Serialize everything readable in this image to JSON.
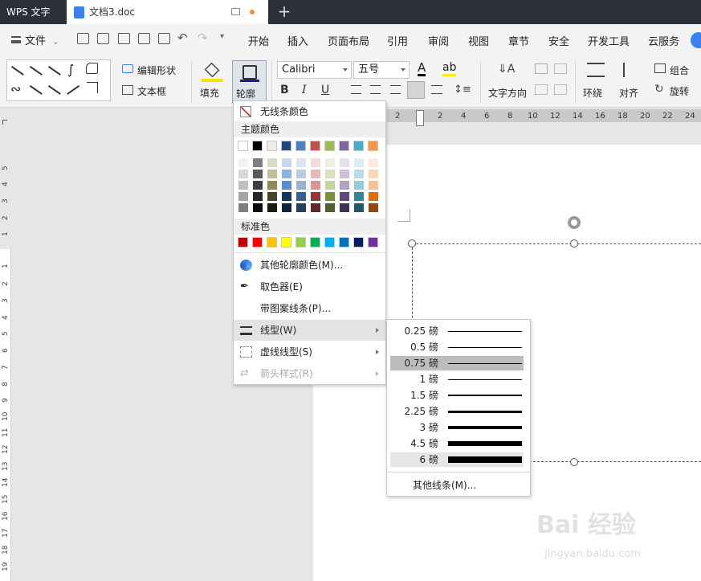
{
  "titlebar": {
    "app_label": "WPS 文字",
    "doc_tab": "文档3.doc",
    "new_tab": "+"
  },
  "menubar": {
    "file": "文件",
    "tabs": [
      "开始",
      "插入",
      "页面布局",
      "引用",
      "审阅",
      "视图",
      "章节",
      "安全",
      "开发工具",
      "云服务"
    ]
  },
  "ribbon": {
    "edit_shape": "编辑形状",
    "text_box": "文本框",
    "fill": "填充",
    "outline": "轮廓",
    "font_name": "Calibri",
    "font_size": "五号",
    "bold": "B",
    "italic": "I",
    "underline": "U",
    "text_direction": "文字方向",
    "wrap": "环绕",
    "align": "对齐",
    "group": "组合",
    "rotate": "旋转"
  },
  "ruler": {
    "h_ticks": [
      "2",
      "2",
      "4",
      "6",
      "8",
      "10",
      "12",
      "14",
      "16",
      "18",
      "20",
      "22",
      "24"
    ],
    "v_ticks_top": [
      "5",
      "4",
      "3",
      "2",
      "1"
    ],
    "v_ticks_bottom": [
      "1",
      "2",
      "3",
      "4",
      "5",
      "6",
      "7",
      "8",
      "9",
      "10",
      "11",
      "12",
      "13",
      "14",
      "15",
      "16",
      "17",
      "18",
      "19"
    ]
  },
  "outline_menu": {
    "no_line": "无线条颜色",
    "theme_colors_title": "主题颜色",
    "standard_colors_title": "标准色",
    "theme_top_row": [
      "#ffffff",
      "#000000",
      "#eeece1",
      "#1f497d",
      "#4f81bd",
      "#c0504d",
      "#9bbb59",
      "#8064a2",
      "#4bacc6",
      "#f79646"
    ],
    "theme_shades": [
      [
        "#f2f2f2",
        "#7f7f7f",
        "#ddd9c3",
        "#c6d9f0",
        "#dbe5f1",
        "#f2dcdb",
        "#ebf1dd",
        "#e5e0ec",
        "#dbeef3",
        "#fdeada"
      ],
      [
        "#d8d8d8",
        "#595959",
        "#c4bd97",
        "#8db3e2",
        "#b8cce4",
        "#e5b9b7",
        "#d7e3bc",
        "#ccc1d9",
        "#b7dde8",
        "#fbd5b5"
      ],
      [
        "#bfbfbf",
        "#3f3f3f",
        "#938953",
        "#548dd4",
        "#95b3d7",
        "#d99694",
        "#c3d69b",
        "#b2a2c7",
        "#92cddc",
        "#fac08f"
      ],
      [
        "#a5a5a5",
        "#262626",
        "#494429",
        "#17365d",
        "#366092",
        "#953734",
        "#76923c",
        "#5f497a",
        "#31859b",
        "#e36c09"
      ],
      [
        "#7f7f7f",
        "#0c0c0c",
        "#1d1b10",
        "#0f243e",
        "#244061",
        "#632423",
        "#4f6128",
        "#3f3151",
        "#205867",
        "#974806"
      ]
    ],
    "standard_colors": [
      "#c00000",
      "#ff0000",
      "#ffc000",
      "#ffff00",
      "#92d050",
      "#00b050",
      "#00b0f0",
      "#0070c0",
      "#002060",
      "#7030a0"
    ],
    "more_colors": "其他轮廓颜色(M)...",
    "eyedropper": "取色器(E)",
    "pattern_line": "带图案线条(P)...",
    "line_type": "线型(W)",
    "dash_type": "虚线线型(S)",
    "arrow_style": "箭头样式(R)"
  },
  "line_weights": {
    "items": [
      {
        "label": "0.25 磅",
        "weight": 0.25
      },
      {
        "label": "0.5 磅",
        "weight": 0.5
      },
      {
        "label": "0.75 磅",
        "weight": 0.75
      },
      {
        "label": "1 磅",
        "weight": 1
      },
      {
        "label": "1.5 磅",
        "weight": 1.5
      },
      {
        "label": "2.25 磅",
        "weight": 2.25
      },
      {
        "label": "3 磅",
        "weight": 3
      },
      {
        "label": "4.5 磅",
        "weight": 4.5
      },
      {
        "label": "6 磅",
        "weight": 6
      }
    ],
    "selected": "0.75 磅",
    "more": "其他线条(M)..."
  },
  "watermark": {
    "brand": "Bai 经验",
    "url": "jingyan.baidu.com"
  }
}
